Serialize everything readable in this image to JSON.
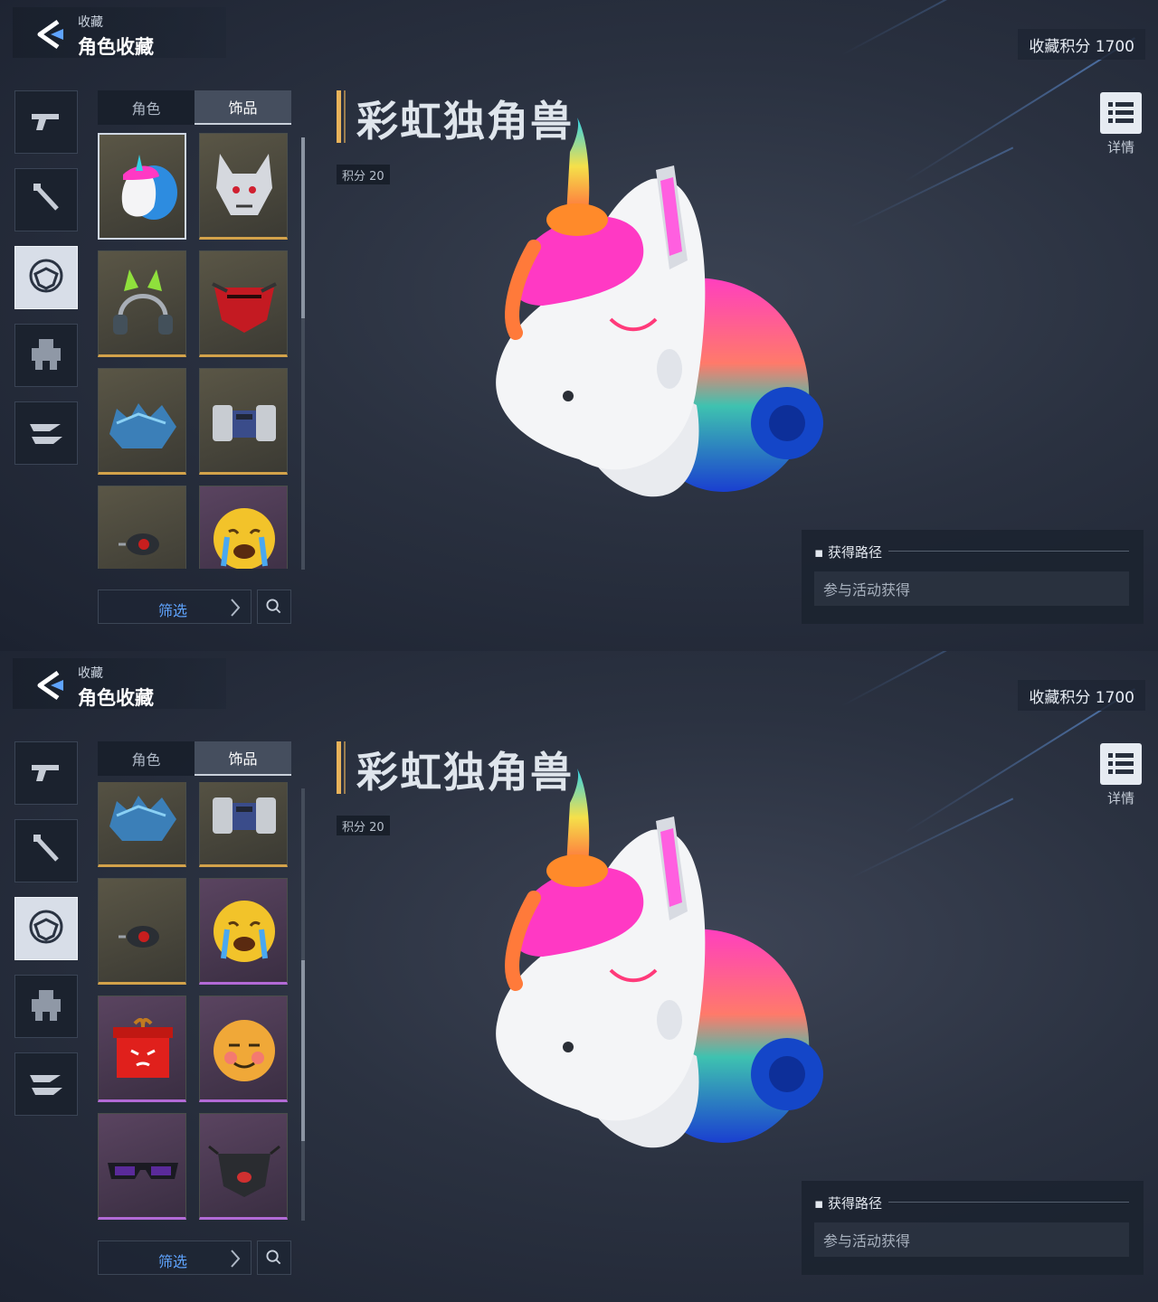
{
  "screens": [
    {
      "header": {
        "crumb": "收藏",
        "title": "角色收藏"
      },
      "collection_points": "收藏积分 1700",
      "sidebar": [
        "pistol-icon",
        "melee-icon",
        "mask-icon",
        "mech-icon",
        "vehicle-icon"
      ],
      "tabs": {
        "character": "角色",
        "accessory": "饰品",
        "active": "饰品"
      },
      "grid": [
        "unicorn-head",
        "wolf-mask",
        "cat-ear-headset",
        "red-mask",
        "blue-crystal-armor",
        "mech-shoulder-armor",
        "red-eye-device",
        "crying-emoji-head"
      ],
      "filter_label": "筛选",
      "item": {
        "name": "彩虹独角兽",
        "score": "积分 20",
        "detail_label": "详情"
      },
      "source": {
        "heading": "获得路径",
        "method": "参与活动获得"
      }
    },
    {
      "header": {
        "crumb": "收藏",
        "title": "角色收藏"
      },
      "collection_points": "收藏积分 1700",
      "sidebar": [
        "pistol-icon",
        "melee-icon",
        "mask-icon",
        "mech-icon",
        "vehicle-icon"
      ],
      "tabs": {
        "character": "角色",
        "accessory": "饰品",
        "active": "饰品"
      },
      "grid": [
        "blue-crystal-armor",
        "mech-shoulder-armor",
        "red-eye-device",
        "crying-emoji-head",
        "angry-gift-box",
        "smug-emoji-head",
        "purple-glasses",
        "black-face-mask"
      ],
      "filter_label": "筛选",
      "item": {
        "name": "彩虹独角兽",
        "score": "积分 20",
        "detail_label": "详情"
      },
      "source": {
        "heading": "获得路径",
        "method": "参与活动获得"
      }
    }
  ],
  "colors": {
    "accent_gold": "#e9b35a",
    "accent_purple": "#b26ad6",
    "link_blue": "#5fa4ff"
  }
}
